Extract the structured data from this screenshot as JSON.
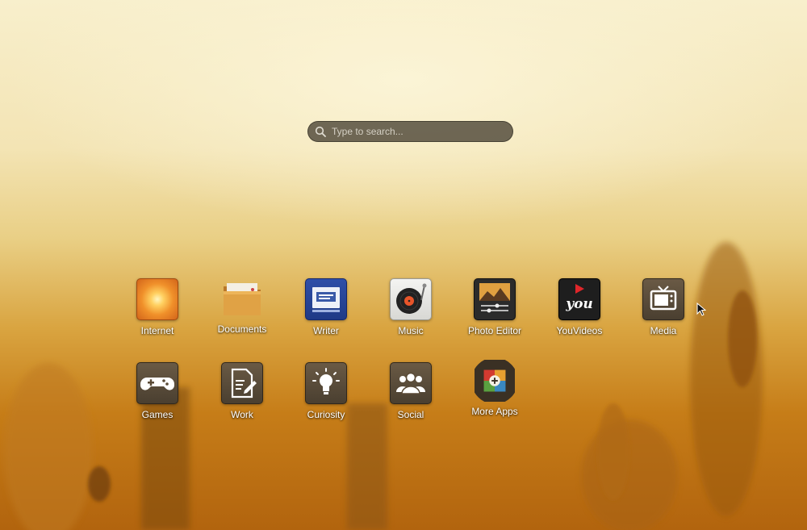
{
  "search": {
    "placeholder": "Type to search..."
  },
  "apps": [
    {
      "label": "Internet",
      "icon": "internet-icon"
    },
    {
      "label": "Documents",
      "icon": "folder-icon"
    },
    {
      "label": "Writer",
      "icon": "writer-icon"
    },
    {
      "label": "Music",
      "icon": "turntable-icon"
    },
    {
      "label": "Photo Editor",
      "icon": "photo-editor-icon"
    },
    {
      "label": "YouVideos",
      "icon": "youvideos-icon",
      "badge_text": "you"
    },
    {
      "label": "Media",
      "icon": "tv-icon"
    },
    {
      "label": "Games",
      "icon": "gamepad-icon"
    },
    {
      "label": "Work",
      "icon": "document-edit-icon"
    },
    {
      "label": "Curiosity",
      "icon": "lightbulb-icon"
    },
    {
      "label": "Social",
      "icon": "people-icon"
    },
    {
      "label": "More Apps",
      "icon": "app-store-icon"
    }
  ],
  "colors": {
    "search_bg": "#4a4334",
    "label_text": "#ffffff",
    "folder_icon_bg": "#3a3024"
  }
}
